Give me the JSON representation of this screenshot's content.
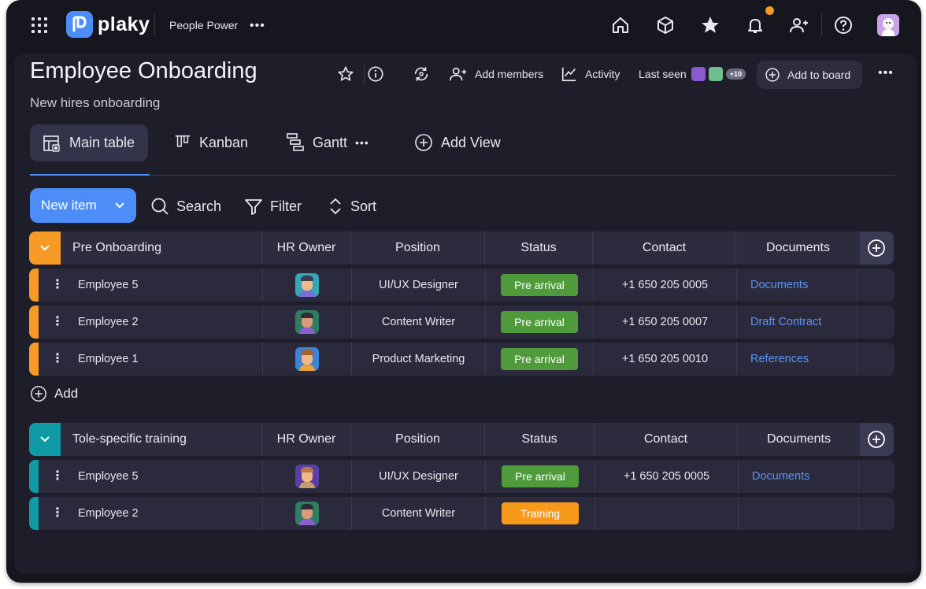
{
  "app": {
    "logo_text": "plaky",
    "workspace": "People Power",
    "workspace_more": "•••"
  },
  "board": {
    "title": "Employee Onboarding",
    "subtitle": "New hires onboarding",
    "add_members_label": "Add members",
    "activity_label": "Activity",
    "last_seen_label": "Last seen",
    "last_seen_extra": "+10",
    "add_to_board_label": "Add to board",
    "more": "•••"
  },
  "views": {
    "main_table": "Main table",
    "kanban": "Kanban",
    "gantt": "Gantt",
    "gantt_more": "•••",
    "add_view": "Add View"
  },
  "toolbar": {
    "new_item": "New item",
    "search": "Search",
    "filter": "Filter",
    "sort": "Sort"
  },
  "columns": {
    "hr_owner": "HR Owner",
    "position": "Position",
    "status": "Status",
    "contact": "Contact",
    "documents": "Documents"
  },
  "groups": [
    {
      "name": "Pre Onboarding",
      "color": "#f79a25",
      "add_label": "Add",
      "rows": [
        {
          "name": "Employee 5",
          "avatar": "avatar-teal",
          "position": "UI/UX Designer",
          "status": "Pre arrival",
          "status_color": "#4f9b3c",
          "contact": "+1 650 205 0005",
          "document": "Documents"
        },
        {
          "name": "Employee 2",
          "avatar": "avatar-green",
          "position": "Content Writer",
          "status": "Pre arrival",
          "status_color": "#4f9b3c",
          "contact": "+1 650 205 0007",
          "document": "Draft Contract"
        },
        {
          "name": "Employee 1",
          "avatar": "avatar-blue",
          "position": "Product Marketing",
          "status": "Pre arrival",
          "status_color": "#4f9b3c",
          "contact": "+1 650 205 0010",
          "document": "References"
        }
      ]
    },
    {
      "name": "Tole-specific training",
      "color": "#0f9aa6",
      "rows": [
        {
          "name": "Employee 5",
          "avatar": "avatar-purple",
          "position": "UI/UX Designer",
          "status": "Pre arrival",
          "status_color": "#4f9b3c",
          "contact": "+1 650 205 0005",
          "document": "Documents"
        },
        {
          "name": "Employee 2",
          "avatar": "avatar-green",
          "position": "Content Writer",
          "status": "Training",
          "status_color": "#f79a1b",
          "contact": "",
          "document": ""
        }
      ]
    }
  ],
  "colors": {
    "accent": "#4d8df7",
    "background": "#16161f",
    "panel": "#1e1e2b",
    "row": "#2a2a3c",
    "notification": "#f79a25"
  }
}
